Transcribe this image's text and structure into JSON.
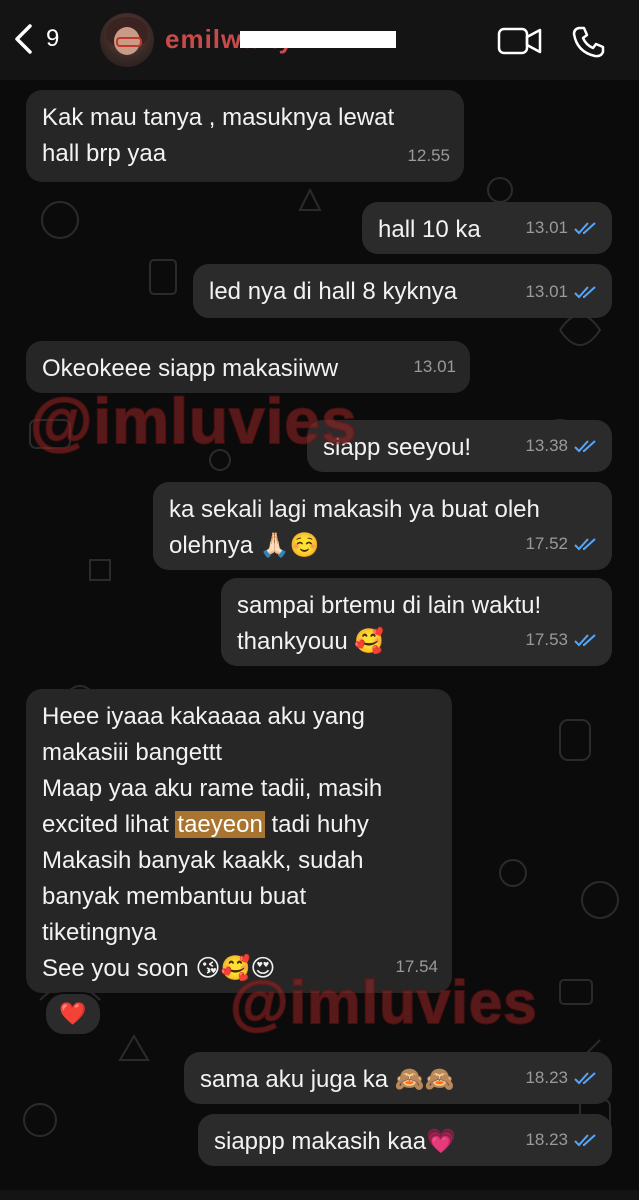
{
  "header": {
    "back_count": "9",
    "contact_name": "emilwarty",
    "icons": {
      "back": "chevron-left-icon",
      "video": "video-camera-icon",
      "call": "phone-icon"
    }
  },
  "messages": [
    {
      "dir": "in",
      "text": "Kak mau tanya , masuknya lewat\nhall brp yaa",
      "time": "12.55"
    },
    {
      "dir": "out",
      "text": "hall 10 ka",
      "time": "13.01",
      "status": "read"
    },
    {
      "dir": "out",
      "text": "led nya di hall 8 kyknya",
      "time": "13.01",
      "status": "read"
    },
    {
      "dir": "in",
      "text": "Okeokeee siapp makasiiww",
      "time": "13.01"
    },
    {
      "dir": "out",
      "text": "siapp seeyou!",
      "time": "13.38",
      "status": "read"
    },
    {
      "dir": "out",
      "text": "ka sekali lagi makasih ya buat oleh\nolehnya 🙏🏻☺️",
      "time": "17.52",
      "status": "read"
    },
    {
      "dir": "out",
      "text": "sampai brtemu di lain waktu!\nthankyouu 🥰",
      "time": "17.53",
      "status": "read"
    },
    {
      "dir": "in",
      "text_a": "Heee iyaaa kakaaaa aku yang\nmakasiii bangettt\nMaap yaa aku rame tadii, masih\nexcited lihat ",
      "highlight": "taeyeon",
      "text_b": " tadi huhy\nMakasih banyak kaakk, sudah\nbanyak membantuu buat\ntiketingnya\nSee you soon 😘🥰😍",
      "time": "17.54",
      "reaction": "❤️"
    },
    {
      "dir": "out",
      "text": "sama aku juga ka 🙈🙈",
      "time": "18.23",
      "status": "read"
    },
    {
      "dir": "out",
      "text": "siappp makasih kaa💗",
      "time": "18.23",
      "status": "read"
    }
  ],
  "watermarks": [
    "@imluvies",
    "@imluvies",
    "@imluvies"
  ],
  "colors": {
    "tick": "#53a6ff",
    "highlight": "#a9742f",
    "watermark": "#9b2c2c"
  }
}
